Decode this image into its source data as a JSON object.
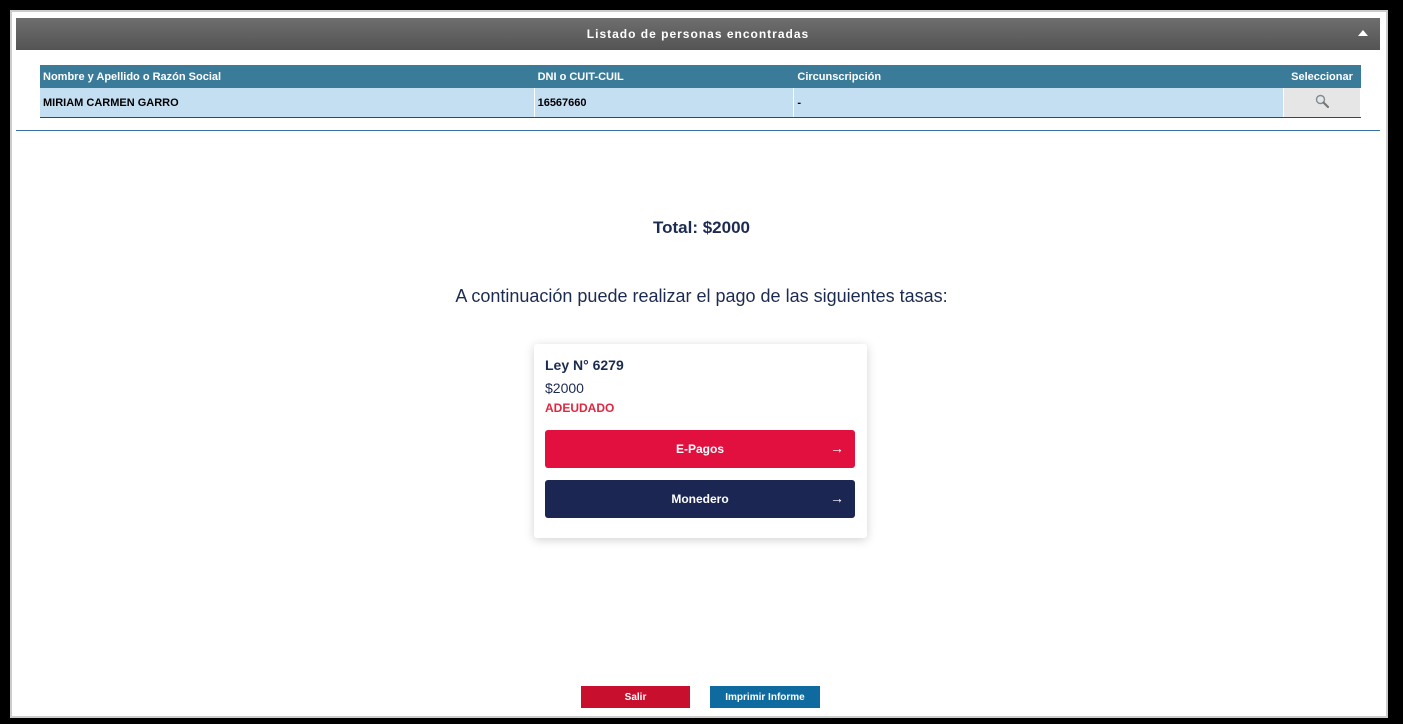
{
  "panel": {
    "title": "Listado de personas encontradas"
  },
  "table": {
    "headers": [
      "Nombre y Apellido o Razón Social",
      "DNI o CUIT-CUIL",
      "Circunscripción",
      "Seleccionar"
    ],
    "rows": [
      {
        "name": "MIRIAM CARMEN GARRO",
        "dni": "16567660",
        "circunscripcion": "-"
      }
    ]
  },
  "summary": {
    "total": "Total: $2000",
    "subtitle": "A continuación puede realizar el pago de las siguientes tasas:"
  },
  "card": {
    "title": "Ley N° 6279",
    "amount": "$2000",
    "status": "ADEUDADO",
    "status_color": "#e0273f",
    "buttons": [
      {
        "label": "E-Pagos",
        "color": "#e2103f"
      },
      {
        "label": "Monedero",
        "color": "#1b2652"
      }
    ]
  },
  "footer": {
    "exit_label": "Salir",
    "print_label": "Imprimir Informe"
  }
}
